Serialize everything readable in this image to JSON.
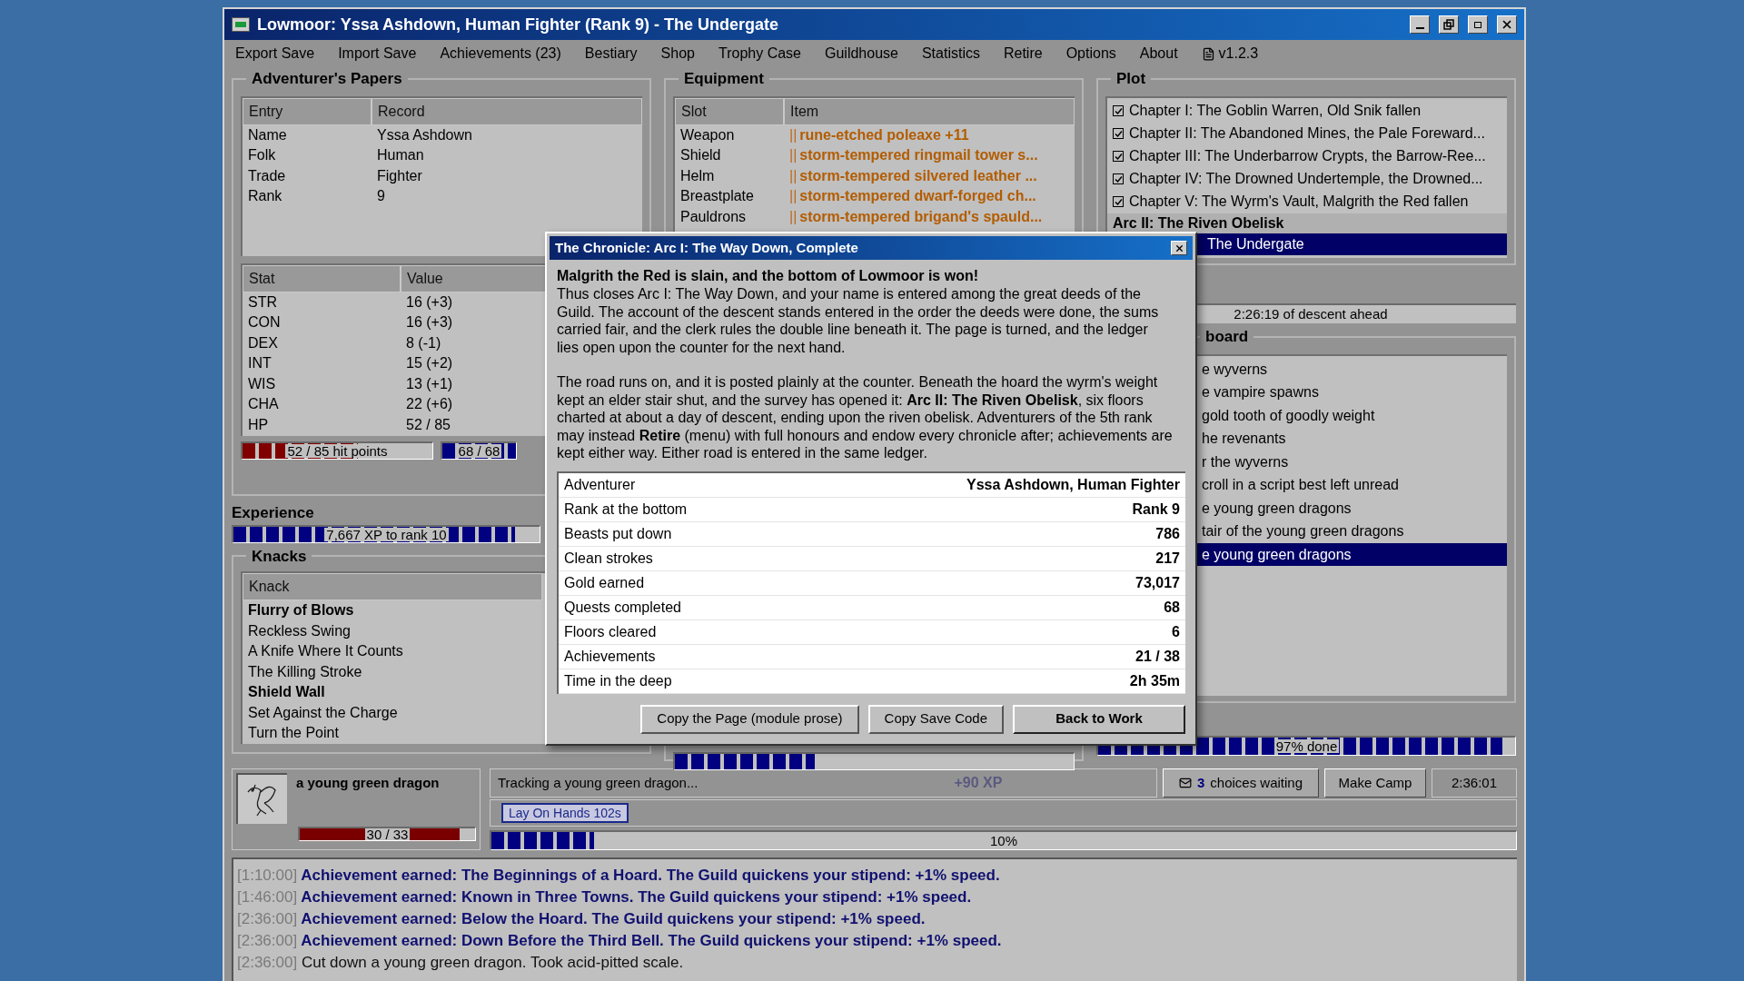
{
  "window": {
    "title": "Lowmoor: Yssa Ashdown, Human Fighter (Rank 9) - The Undergate"
  },
  "menu": [
    {
      "kind": "item",
      "label": "Export Save"
    },
    {
      "kind": "item",
      "label": "Import Save"
    },
    {
      "kind": "item",
      "label": "Achievements (23)"
    },
    {
      "kind": "item",
      "label": "Bestiary"
    },
    {
      "kind": "item",
      "label": "Shop"
    },
    {
      "kind": "item",
      "label": "Trophy Case"
    },
    {
      "kind": "item",
      "label": "Guildhouse"
    },
    {
      "kind": "item",
      "label": "Statistics"
    },
    {
      "kind": "item",
      "label": "Retire"
    },
    {
      "kind": "item",
      "label": "Options"
    },
    {
      "kind": "item",
      "label": "About"
    },
    {
      "kind": "version",
      "label": "v1.2.3"
    }
  ],
  "papers": {
    "title": "Adventurer's Papers",
    "record_columns": [
      "Entry",
      "Record"
    ],
    "records": [
      [
        "Name",
        "Yssa Ashdown"
      ],
      [
        "Folk",
        "Human"
      ],
      [
        "Trade",
        "Fighter"
      ],
      [
        "Rank",
        "9"
      ]
    ],
    "stat_columns": [
      "Stat",
      "Value"
    ],
    "stats": [
      [
        "STR",
        "16 (+3)"
      ],
      [
        "CON",
        "16 (+3)"
      ],
      [
        "DEX",
        "8 (-1)"
      ],
      [
        "INT",
        "15 (+2)"
      ],
      [
        "WIS",
        "13 (+1)"
      ],
      [
        "CHA",
        "22 (+6)"
      ],
      [
        "HP",
        "52 / 85"
      ]
    ],
    "hp_bar": {
      "reading": "52 / 85 hit points",
      "level": 0.61
    },
    "mp_bar": {
      "reading": "68 / 68",
      "level": 1
    }
  },
  "experience": {
    "title": "Experience",
    "reading": "7,667 XP to rank 10",
    "level": 0.92
  },
  "knacks": {
    "title": "Knacks",
    "column": "Knack",
    "items": [
      {
        "name": "Flurry of Blows",
        "bold": true
      },
      {
        "name": "Reckless Swing",
        "bold": false
      },
      {
        "name": "A Knife Where It Counts",
        "bold": false
      },
      {
        "name": "The Killing Stroke",
        "bold": false
      },
      {
        "name": "Shield Wall",
        "bold": true
      },
      {
        "name": "Set Against the Charge",
        "bold": false
      },
      {
        "name": "Turn the Point",
        "bold": false
      }
    ]
  },
  "equipment": {
    "title": "Equipment",
    "columns": [
      "Slot",
      "Item"
    ],
    "rows": [
      {
        "slot": "Weapon",
        "mark": "||",
        "item": "rune-etched poleaxe +11"
      },
      {
        "slot": "Shield",
        "mark": "||",
        "item": "storm-tempered ringmail tower s..."
      },
      {
        "slot": "Helm",
        "mark": "||",
        "item": "storm-tempered silvered leather ..."
      },
      {
        "slot": "Breastplate",
        "mark": "||",
        "item": "storm-tempered dwarf-forged ch..."
      },
      {
        "slot": "Pauldrons",
        "mark": "||",
        "item": "storm-tempered brigand's spauld..."
      }
    ],
    "load_bar": {
      "level": 0.35
    }
  },
  "plot": {
    "title": "Plot",
    "items": [
      {
        "kind": "chapter",
        "label": "Chapter I: The Goblin Warren, Old Snik fallen",
        "checked": true,
        "selected": false
      },
      {
        "kind": "chapter",
        "label": "Chapter II: The Abandoned Mines, the Pale Foreward...",
        "checked": true,
        "selected": false
      },
      {
        "kind": "chapter",
        "label": "Chapter III: The Underbarrow Crypts, the Barrow-Ree...",
        "checked": true,
        "selected": false
      },
      {
        "kind": "chapter",
        "label": "Chapter IV: The Drowned Undertemple, the Drowned...",
        "checked": true,
        "selected": false
      },
      {
        "kind": "chapter",
        "label": "Chapter V: The Wyrm's Vault, Malgrith the Red fallen",
        "checked": true,
        "selected": false
      },
      {
        "kind": "arc",
        "label": "Arc II: The Riven Obelisk",
        "selected": false
      },
      {
        "kind": "current",
        "label": "The Undergate",
        "selected": true
      }
    ]
  },
  "descent": {
    "reading": "2:26:19 of descent ahead"
  },
  "quest_board": {
    "title": "board",
    "items": [
      {
        "label": "e wyverns",
        "selected": false
      },
      {
        "label": "e vampire spawns",
        "selected": false
      },
      {
        "label": "gold tooth of goodly weight",
        "selected": false
      },
      {
        "label": "he revenants",
        "selected": false
      },
      {
        "label": "r the wyverns",
        "selected": false
      },
      {
        "label": "croll in a script best left unread",
        "selected": false
      },
      {
        "label": "e young green dragons",
        "selected": false
      },
      {
        "label": "tair of the young green dragons",
        "selected": false
      },
      {
        "label": "e young green dragons",
        "selected": true
      }
    ],
    "progress": {
      "reading": "97% done",
      "level": 0.97
    }
  },
  "encounter": {
    "name": "a young green dragon",
    "hp": {
      "reading": "30 / 33",
      "level": 0.91
    }
  },
  "tracking": {
    "text": "Tracking a young green dragon...",
    "gain": "+90 XP"
  },
  "choices_button": {
    "count": "3",
    "label": "choices waiting"
  },
  "camp_button": {
    "label": "Make Camp"
  },
  "clock": "2:36:01",
  "buffs": [
    {
      "label": "Lay On Hands 102s"
    }
  ],
  "task_progress": {
    "reading": "10%",
    "level": 0.1
  },
  "log": [
    {
      "time": "[1:10:00]",
      "kind": "achievement",
      "text": "Achievement earned: The Beginnings of a Hoard. The Guild quickens your stipend: +1% speed."
    },
    {
      "time": "[1:46:00]",
      "kind": "achievement",
      "text": "Achievement earned: Known in Three Towns. The Guild quickens your stipend: +1% speed."
    },
    {
      "time": "[2:36:00]",
      "kind": "achievement",
      "text": "Achievement earned: Below the Hoard. The Guild quickens your stipend: +1% speed."
    },
    {
      "time": "[2:36:00]",
      "kind": "achievement",
      "text": "Achievement earned: Down Before the Third Bell. The Guild quickens your stipend: +1% speed."
    },
    {
      "time": "[2:36:00]",
      "kind": "plain",
      "text": "Cut down a young green dragon. Took acid-pitted scale."
    }
  ],
  "dialog": {
    "title": "The Chronicle: Arc I: The Way Down, Complete",
    "heading": "Malgrith the Red is slain, and the bottom of Lowmoor is won!",
    "paragraphs": [
      "Thus closes Arc I: The Way Down, and your name is entered among the great deeds of the Guild. The account of the descent stands entered in the order the deeds were done, the sums carried fair, and the clerk rules the double line beneath it. The page is turned, and the ledger lies open upon the counter for the next hand.",
      "The road runs on, and it is posted plainly at the counter. Beneath the hoard the wyrm's weight kept an elder stair shut, and the survey has opened it: **Arc II: The Riven Obelisk**, six floors charted at about a day of descent, ending upon the riven obelisk. Adventurers of the 5th rank may instead **Retire** (menu) with full honours and endow every chronicle after; achievements are kept either way. Either road is entered in the same ledger."
    ],
    "summary": [
      [
        "Adventurer",
        "Yssa Ashdown, Human Fighter"
      ],
      [
        "Rank at the bottom",
        "Rank 9"
      ],
      [
        "Beasts put down",
        "786"
      ],
      [
        "Clean strokes",
        "217"
      ],
      [
        "Gold earned",
        "73,017"
      ],
      [
        "Quests completed",
        "68"
      ],
      [
        "Floors cleared",
        "6"
      ],
      [
        "Achievements",
        "21 / 38"
      ],
      [
        "Time in the deep",
        "2h 35m"
      ]
    ],
    "buttons": [
      {
        "label": "Copy the Page (module prose)",
        "default": false
      },
      {
        "label": "Copy Save Code",
        "default": false
      },
      {
        "label": "Back to Work",
        "default": true
      }
    ]
  }
}
